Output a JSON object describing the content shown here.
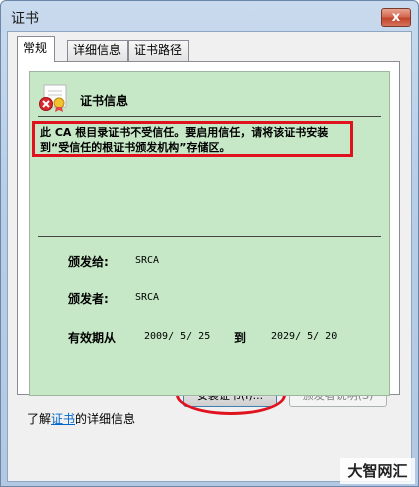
{
  "window": {
    "title": "证书",
    "close_label": "x"
  },
  "tabs": [
    {
      "label": "常规",
      "active": true
    },
    {
      "label": "详细信息",
      "active": false
    },
    {
      "label": "证书路径",
      "active": false
    }
  ],
  "general": {
    "section_title": "证书信息",
    "warning_text": "此 CA 根目录证书不受信任。要启用信任，请将该证书安装到“受信任的根证书颁发机构”存储区。",
    "issued_to_label": "颁发给:",
    "issued_to_value": "SRCA",
    "issued_by_label": "颁发者:",
    "issued_by_value": "SRCA",
    "valid_label": "有效期从",
    "valid_from": "2009/ 5/ 25",
    "valid_to_label": "到",
    "valid_to": "2029/ 5/ 20"
  },
  "buttons": {
    "install": "安装证书(I)...",
    "issuer_statement": "颁发者说明(S)"
  },
  "footer": {
    "learn_prefix": "了解",
    "learn_link": "证书",
    "learn_suffix": "的详细信息"
  },
  "watermark": "大智网汇",
  "colors": {
    "warning_border": "#e0121e",
    "info_background": "#c6e8c6",
    "link": "#0066cc"
  }
}
